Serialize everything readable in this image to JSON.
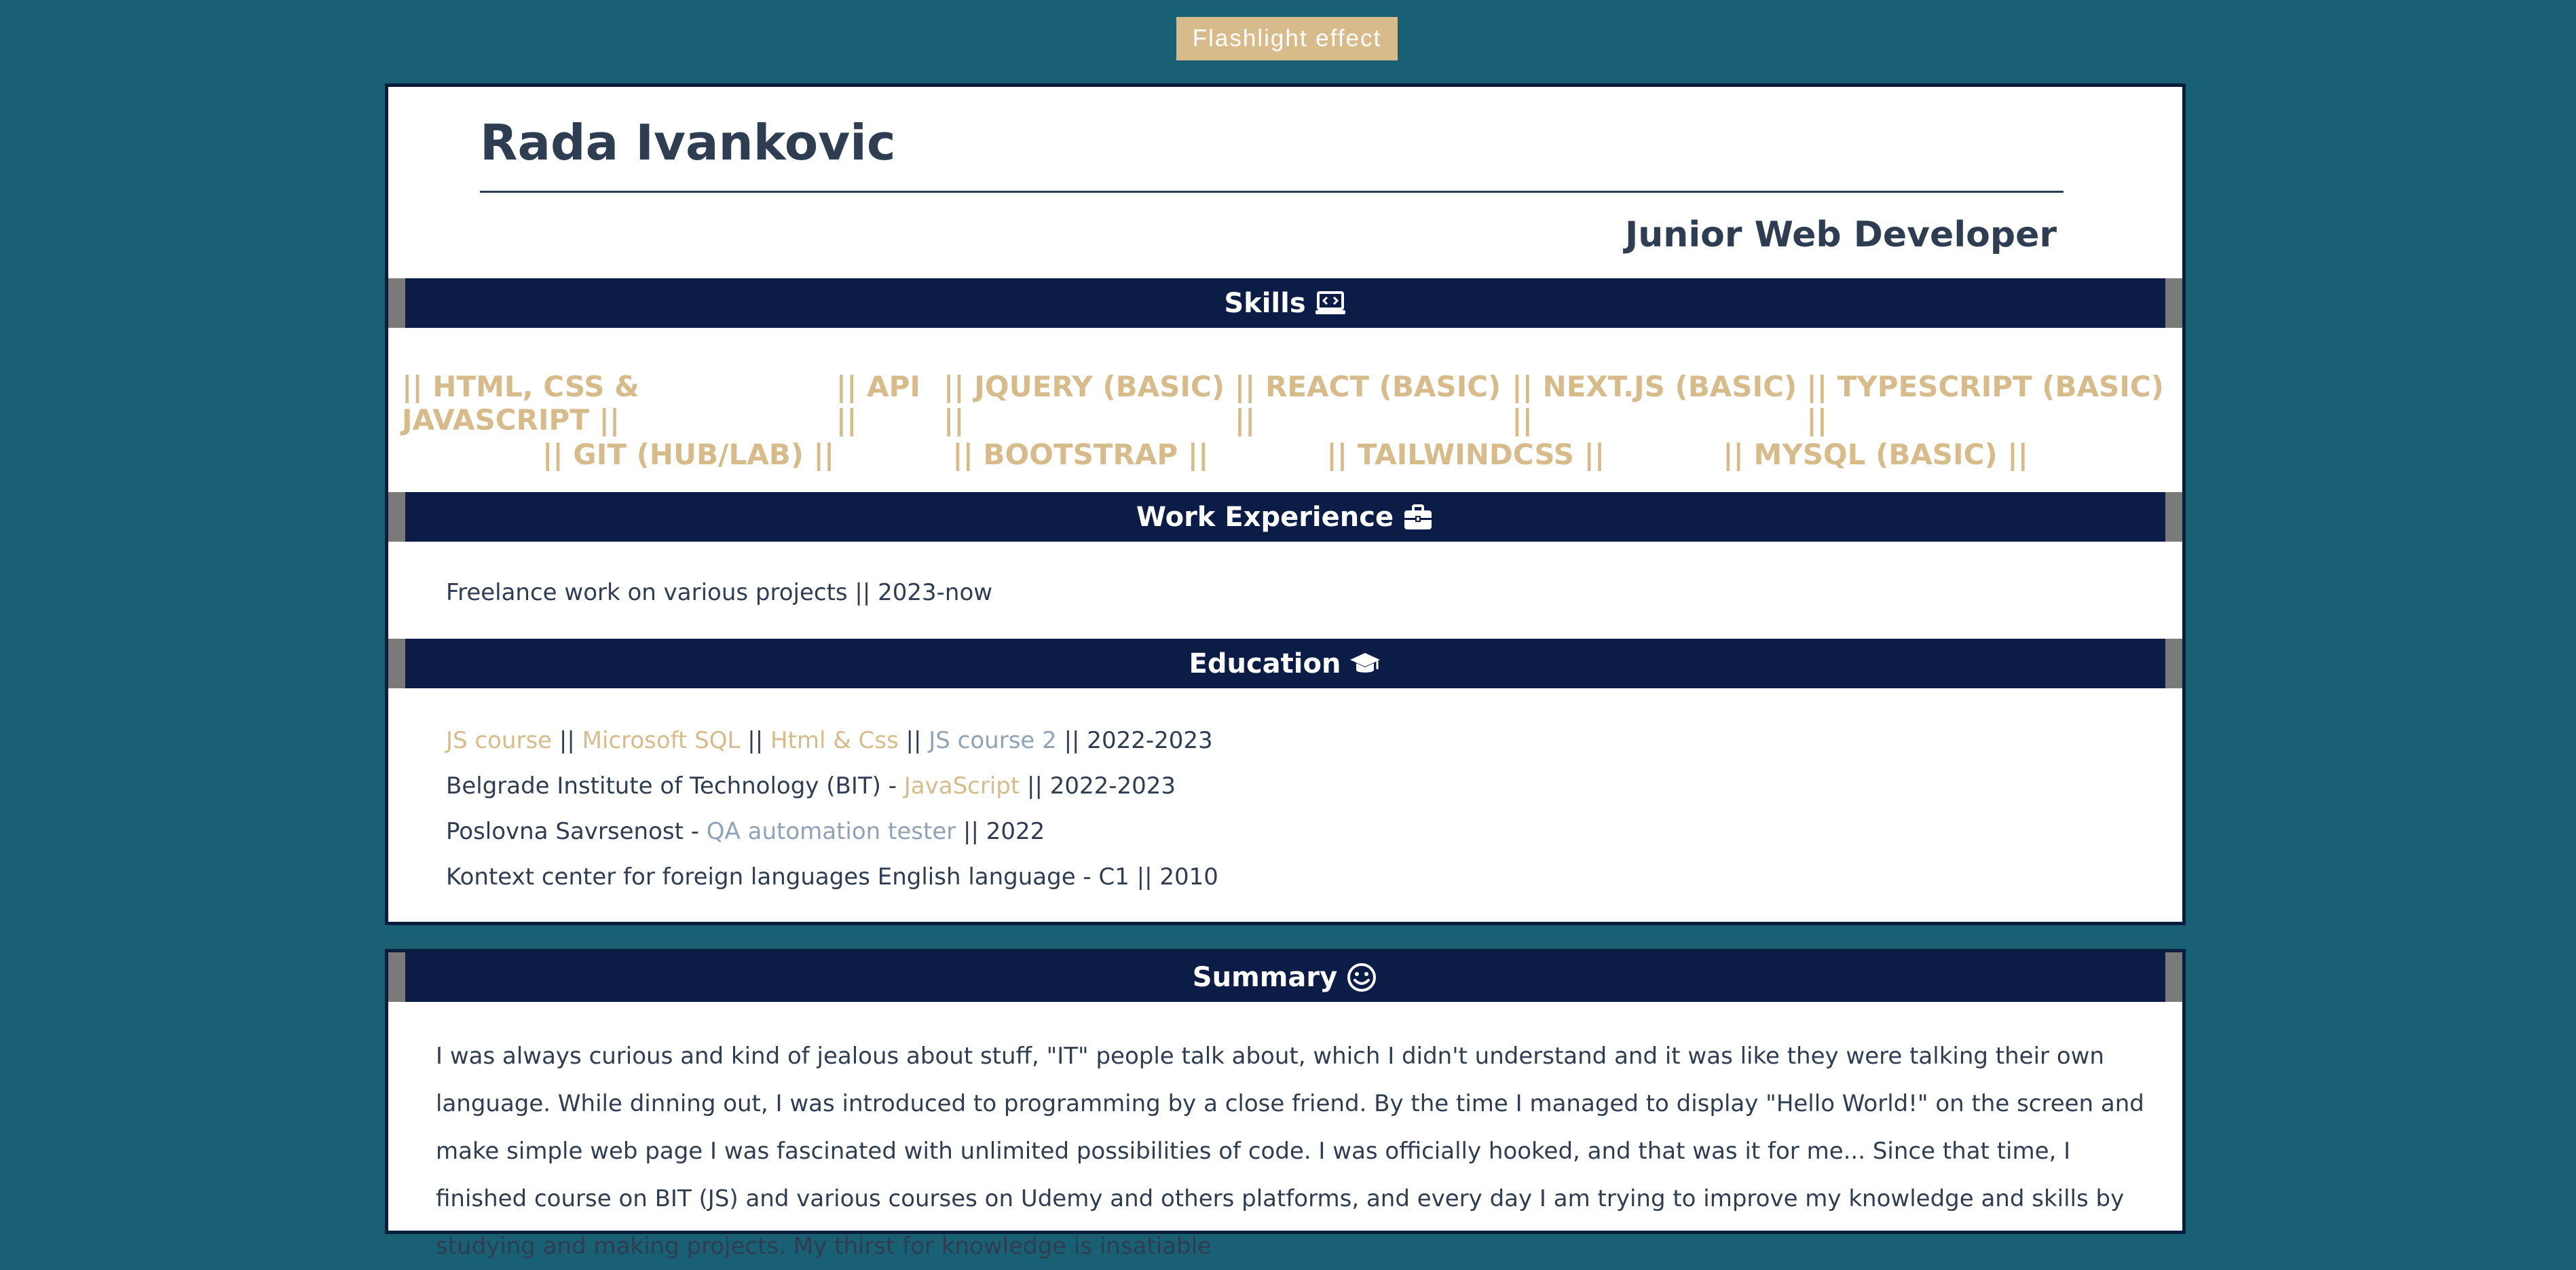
{
  "flashlight_button": {
    "label": "Flashlight effect"
  },
  "header": {
    "name": "Rada Ivankovic",
    "job_title": "Junior Web Developer"
  },
  "sections": {
    "skills": {
      "title": "Skills",
      "icon": "laptop-code-icon"
    },
    "work": {
      "title": "Work Experience",
      "icon": "briefcase-icon"
    },
    "education": {
      "title": "Education",
      "icon": "graduation-cap-icon"
    },
    "summary": {
      "title": "Summary",
      "icon": "smile-icon"
    }
  },
  "skills": {
    "row1": [
      "|| HTML, CSS & JAVASCRIPT ||",
      "|| API ||",
      "|| JQUERY (BASIC) ||",
      "|| REACT (BASIC) ||",
      "|| NEXT.JS (BASIC) ||",
      "|| TYPESCRIPT (BASIC) ||"
    ],
    "row2": [
      "|| GIT (HUB/LAB) ||",
      "|| BOOTSTRAP ||",
      "|| TAILWINDCSS ||",
      "|| MYSQL (BASIC) ||"
    ]
  },
  "work": {
    "line": "Freelance work on various projects || 2023-now"
  },
  "education": {
    "line1": {
      "link1": "JS course",
      "sep1": " || ",
      "link2": "Microsoft SQL",
      "sep2": " || ",
      "link3": "Html & Css",
      "sep3": " || ",
      "link4": "JS course 2",
      "tail": " || 2022-2023"
    },
    "line2": {
      "prefix": "Belgrade Institute of Technology (BIT) - ",
      "link": "JavaScript",
      "tail": " || 2022-2023"
    },
    "line3": {
      "prefix": "Poslovna Savrsenost - ",
      "link": "QA automation tester",
      "tail": " || 2022"
    },
    "line4": "Kontext center for foreign languages English language - C1 || 2010"
  },
  "summary": {
    "text": "I was always curious and kind of jealous about stuff, \"IT\" people talk about, which I didn't understand and it was like they were talking their own language. While dinning out, I was introduced to programming by a close friend. By the time I managed to display \"Hello World!\" on the screen and make simple web page I was fascinated with unlimited possibilities of code. I was officially hooked, and that was it for me... Since that time, I finished course on BIT (JS) and various courses on Udemy and others platforms, and every day I am trying to improve my knowledge and skills by studying and making projects. My thirst for knowledge is insatiable"
  },
  "colors": {
    "page_background": "#1a6075",
    "section_bar": "#0b1d46",
    "accent_gold": "#d8bb8b",
    "link_blue": "#8fa3b8",
    "text": "#2f3d52"
  }
}
